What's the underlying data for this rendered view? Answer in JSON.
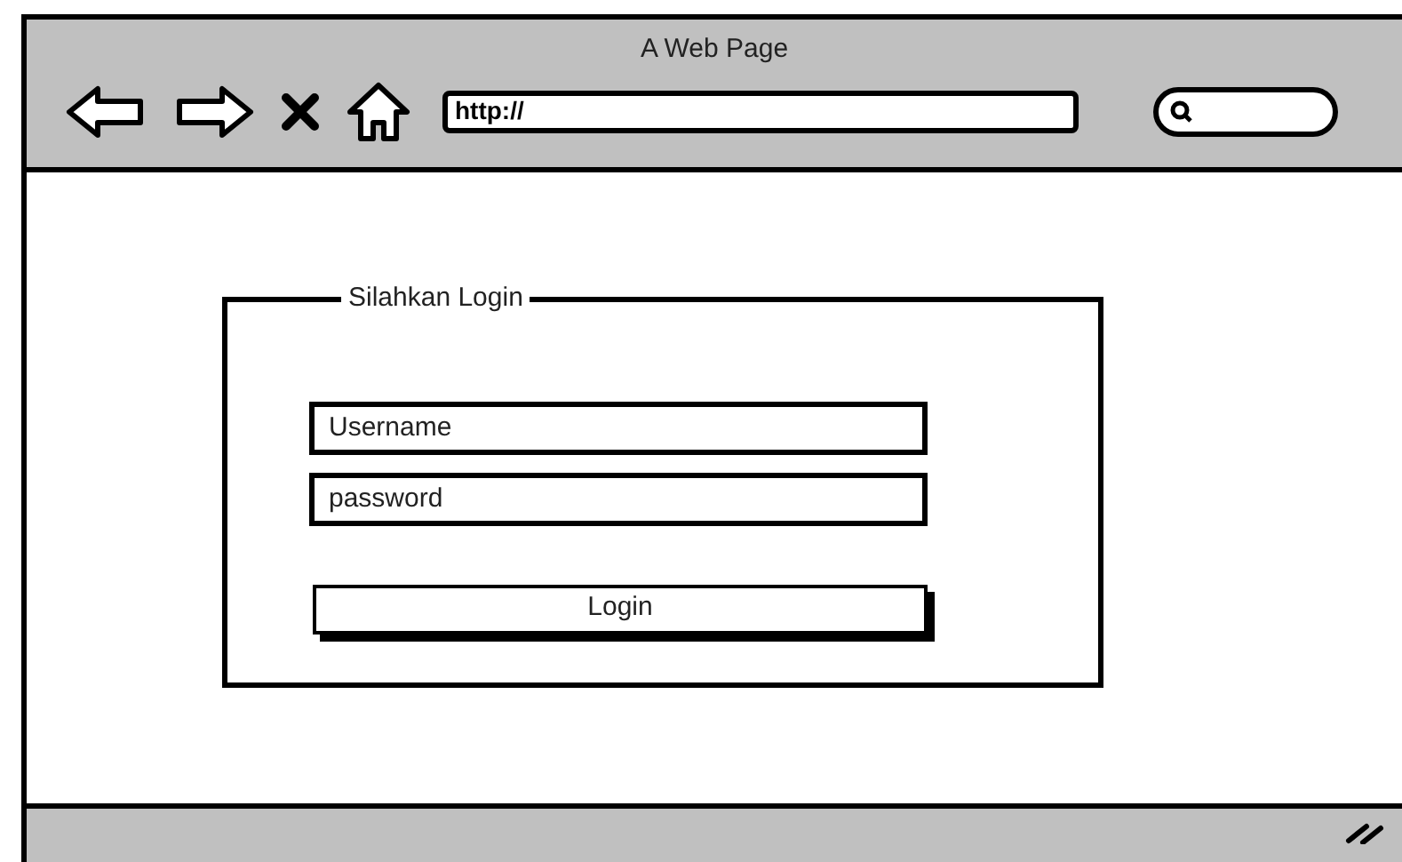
{
  "window": {
    "title": "A Web Page"
  },
  "address_bar": {
    "value": "http://"
  },
  "login_form": {
    "legend": "Silahkan Login",
    "fields": [
      {
        "placeholder": "Username"
      },
      {
        "placeholder": "password"
      }
    ],
    "button": "Login"
  }
}
